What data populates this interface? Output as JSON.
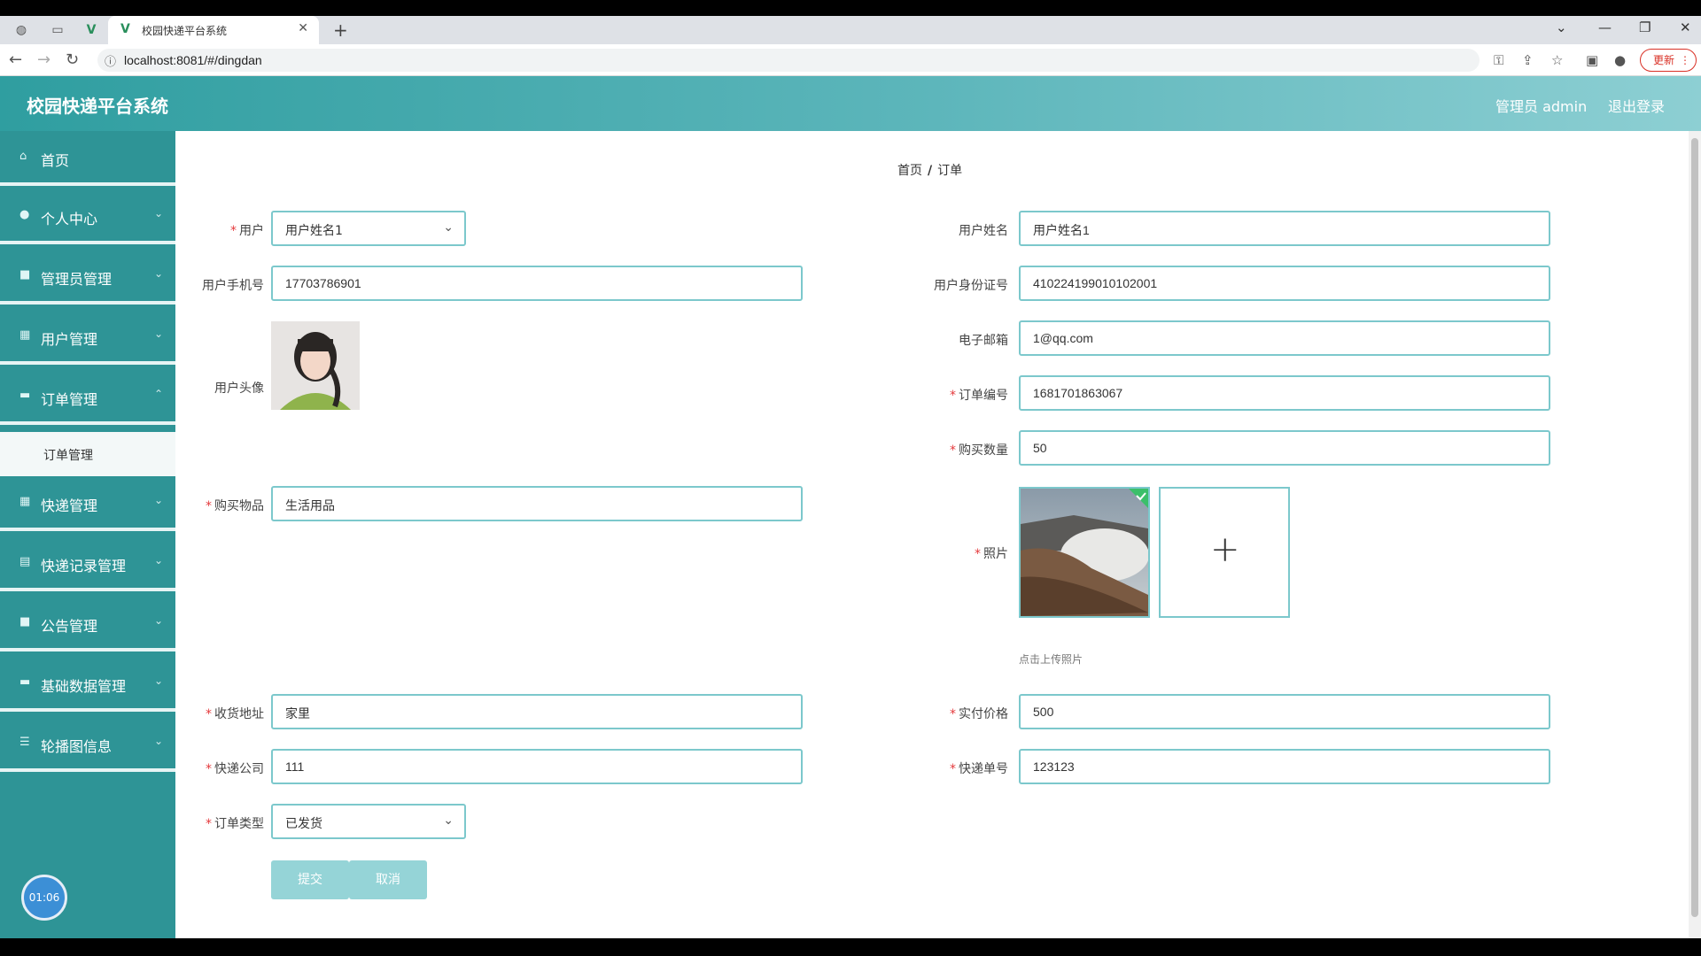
{
  "browser": {
    "tab_title": "校园快递平台系统",
    "url": "localhost:8081/#/dingdan",
    "update_label": "更新"
  },
  "header": {
    "title": "校园快递平台系统",
    "admin_label": "管理员 admin",
    "logout_label": "退出登录"
  },
  "sidebar": {
    "items": [
      {
        "label": "首页"
      },
      {
        "label": "个人中心"
      },
      {
        "label": "管理员管理"
      },
      {
        "label": "用户管理"
      },
      {
        "label": "订单管理"
      },
      {
        "label": "快递管理"
      },
      {
        "label": "快递记录管理"
      },
      {
        "label": "公告管理"
      },
      {
        "label": "基础数据管理"
      },
      {
        "label": "轮播图信息"
      }
    ],
    "submenu_label": "订单管理",
    "timer": "01:06"
  },
  "breadcrumb": {
    "home": "首页",
    "sep": "/",
    "current": "订单"
  },
  "form": {
    "user": {
      "label": "用户",
      "value": "用户姓名1"
    },
    "user_name": {
      "label": "用户姓名",
      "value": "用户姓名1"
    },
    "phone": {
      "label": "用户手机号",
      "value": "17703786901"
    },
    "id_card": {
      "label": "用户身份证号",
      "value": "410224199010102001"
    },
    "email": {
      "label": "电子邮箱",
      "value": "1@qq.com"
    },
    "avatar": {
      "label": "用户头像"
    },
    "order_no": {
      "label": "订单编号",
      "value": "1681701863067"
    },
    "quantity": {
      "label": "购买数量",
      "value": "50"
    },
    "item": {
      "label": "购买物品",
      "value": "生活用品"
    },
    "photo": {
      "label": "照片",
      "tip": "点击上传照片"
    },
    "address": {
      "label": "收货地址",
      "value": "家里"
    },
    "price": {
      "label": "实付价格",
      "value": "500"
    },
    "company": {
      "label": "快递公司",
      "value": "111"
    },
    "tracking_no": {
      "label": "快递单号",
      "value": "123123"
    },
    "order_type": {
      "label": "订单类型",
      "value": "已发货"
    },
    "submit_label": "提交",
    "cancel_label": "取消"
  },
  "colors": {
    "primary": "#2e9496",
    "input_border": "#7cc8cc",
    "required": "#e4393c"
  }
}
